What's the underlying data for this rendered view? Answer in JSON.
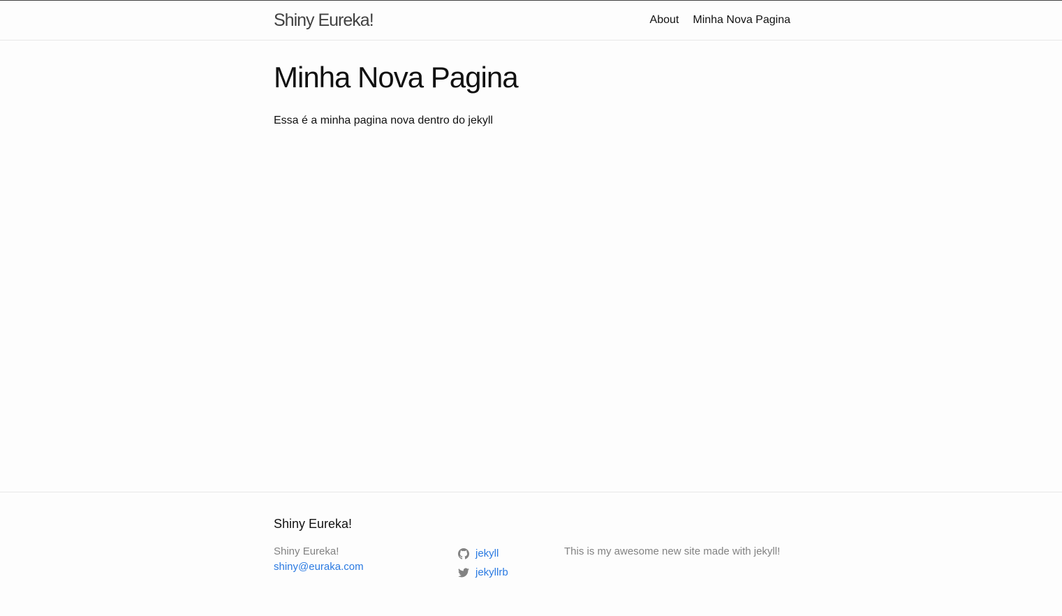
{
  "header": {
    "site_title": "Shiny Eureka!",
    "nav": [
      {
        "label": "About"
      },
      {
        "label": "Minha Nova Pagina"
      }
    ]
  },
  "main": {
    "heading": "Minha Nova Pagina",
    "body": "Essa é a minha pagina nova dentro do jekyll"
  },
  "footer": {
    "heading": "Shiny Eureka!",
    "name": "Shiny Eureka!",
    "email": "shiny@euraka.com",
    "social": [
      {
        "icon": "github-icon",
        "label": "jekyll"
      },
      {
        "icon": "twitter-icon",
        "label": "jekyllrb"
      }
    ],
    "description": "This is my awesome new site made with jekyll!"
  },
  "colors": {
    "link": "#2a7ae2",
    "muted_text": "#828282",
    "text": "#111111"
  }
}
